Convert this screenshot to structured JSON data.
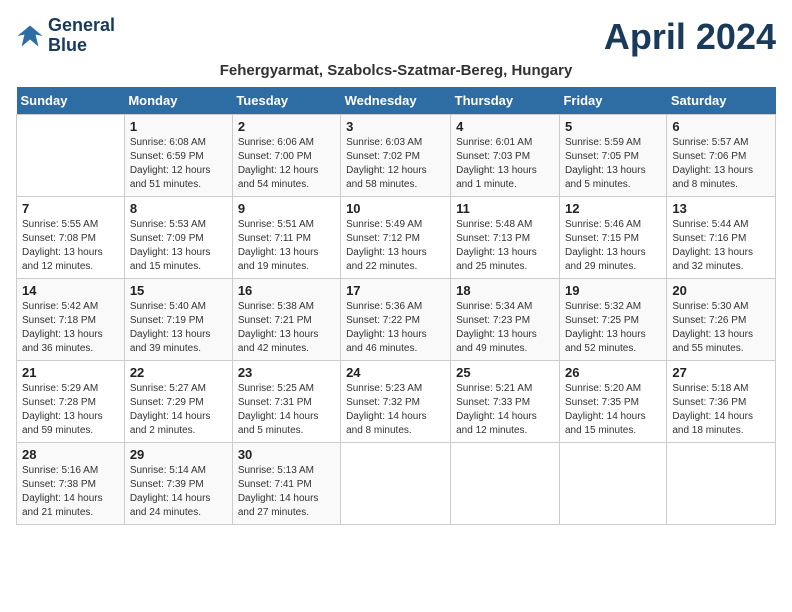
{
  "header": {
    "logo_line1": "General",
    "logo_line2": "Blue",
    "month": "April 2024",
    "location": "Fehergyarmat, Szabolcs-Szatmar-Bereg, Hungary"
  },
  "weekdays": [
    "Sunday",
    "Monday",
    "Tuesday",
    "Wednesday",
    "Thursday",
    "Friday",
    "Saturday"
  ],
  "weeks": [
    [
      {
        "day": "",
        "sunrise": "",
        "sunset": "",
        "daylight": ""
      },
      {
        "day": "1",
        "sunrise": "Sunrise: 6:08 AM",
        "sunset": "Sunset: 6:59 PM",
        "daylight": "Daylight: 12 hours and 51 minutes."
      },
      {
        "day": "2",
        "sunrise": "Sunrise: 6:06 AM",
        "sunset": "Sunset: 7:00 PM",
        "daylight": "Daylight: 12 hours and 54 minutes."
      },
      {
        "day": "3",
        "sunrise": "Sunrise: 6:03 AM",
        "sunset": "Sunset: 7:02 PM",
        "daylight": "Daylight: 12 hours and 58 minutes."
      },
      {
        "day": "4",
        "sunrise": "Sunrise: 6:01 AM",
        "sunset": "Sunset: 7:03 PM",
        "daylight": "Daylight: 13 hours and 1 minute."
      },
      {
        "day": "5",
        "sunrise": "Sunrise: 5:59 AM",
        "sunset": "Sunset: 7:05 PM",
        "daylight": "Daylight: 13 hours and 5 minutes."
      },
      {
        "day": "6",
        "sunrise": "Sunrise: 5:57 AM",
        "sunset": "Sunset: 7:06 PM",
        "daylight": "Daylight: 13 hours and 8 minutes."
      }
    ],
    [
      {
        "day": "7",
        "sunrise": "Sunrise: 5:55 AM",
        "sunset": "Sunset: 7:08 PM",
        "daylight": "Daylight: 13 hours and 12 minutes."
      },
      {
        "day": "8",
        "sunrise": "Sunrise: 5:53 AM",
        "sunset": "Sunset: 7:09 PM",
        "daylight": "Daylight: 13 hours and 15 minutes."
      },
      {
        "day": "9",
        "sunrise": "Sunrise: 5:51 AM",
        "sunset": "Sunset: 7:11 PM",
        "daylight": "Daylight: 13 hours and 19 minutes."
      },
      {
        "day": "10",
        "sunrise": "Sunrise: 5:49 AM",
        "sunset": "Sunset: 7:12 PM",
        "daylight": "Daylight: 13 hours and 22 minutes."
      },
      {
        "day": "11",
        "sunrise": "Sunrise: 5:48 AM",
        "sunset": "Sunset: 7:13 PM",
        "daylight": "Daylight: 13 hours and 25 minutes."
      },
      {
        "day": "12",
        "sunrise": "Sunrise: 5:46 AM",
        "sunset": "Sunset: 7:15 PM",
        "daylight": "Daylight: 13 hours and 29 minutes."
      },
      {
        "day": "13",
        "sunrise": "Sunrise: 5:44 AM",
        "sunset": "Sunset: 7:16 PM",
        "daylight": "Daylight: 13 hours and 32 minutes."
      }
    ],
    [
      {
        "day": "14",
        "sunrise": "Sunrise: 5:42 AM",
        "sunset": "Sunset: 7:18 PM",
        "daylight": "Daylight: 13 hours and 36 minutes."
      },
      {
        "day": "15",
        "sunrise": "Sunrise: 5:40 AM",
        "sunset": "Sunset: 7:19 PM",
        "daylight": "Daylight: 13 hours and 39 minutes."
      },
      {
        "day": "16",
        "sunrise": "Sunrise: 5:38 AM",
        "sunset": "Sunset: 7:21 PM",
        "daylight": "Daylight: 13 hours and 42 minutes."
      },
      {
        "day": "17",
        "sunrise": "Sunrise: 5:36 AM",
        "sunset": "Sunset: 7:22 PM",
        "daylight": "Daylight: 13 hours and 46 minutes."
      },
      {
        "day": "18",
        "sunrise": "Sunrise: 5:34 AM",
        "sunset": "Sunset: 7:23 PM",
        "daylight": "Daylight: 13 hours and 49 minutes."
      },
      {
        "day": "19",
        "sunrise": "Sunrise: 5:32 AM",
        "sunset": "Sunset: 7:25 PM",
        "daylight": "Daylight: 13 hours and 52 minutes."
      },
      {
        "day": "20",
        "sunrise": "Sunrise: 5:30 AM",
        "sunset": "Sunset: 7:26 PM",
        "daylight": "Daylight: 13 hours and 55 minutes."
      }
    ],
    [
      {
        "day": "21",
        "sunrise": "Sunrise: 5:29 AM",
        "sunset": "Sunset: 7:28 PM",
        "daylight": "Daylight: 13 hours and 59 minutes."
      },
      {
        "day": "22",
        "sunrise": "Sunrise: 5:27 AM",
        "sunset": "Sunset: 7:29 PM",
        "daylight": "Daylight: 14 hours and 2 minutes."
      },
      {
        "day": "23",
        "sunrise": "Sunrise: 5:25 AM",
        "sunset": "Sunset: 7:31 PM",
        "daylight": "Daylight: 14 hours and 5 minutes."
      },
      {
        "day": "24",
        "sunrise": "Sunrise: 5:23 AM",
        "sunset": "Sunset: 7:32 PM",
        "daylight": "Daylight: 14 hours and 8 minutes."
      },
      {
        "day": "25",
        "sunrise": "Sunrise: 5:21 AM",
        "sunset": "Sunset: 7:33 PM",
        "daylight": "Daylight: 14 hours and 12 minutes."
      },
      {
        "day": "26",
        "sunrise": "Sunrise: 5:20 AM",
        "sunset": "Sunset: 7:35 PM",
        "daylight": "Daylight: 14 hours and 15 minutes."
      },
      {
        "day": "27",
        "sunrise": "Sunrise: 5:18 AM",
        "sunset": "Sunset: 7:36 PM",
        "daylight": "Daylight: 14 hours and 18 minutes."
      }
    ],
    [
      {
        "day": "28",
        "sunrise": "Sunrise: 5:16 AM",
        "sunset": "Sunset: 7:38 PM",
        "daylight": "Daylight: 14 hours and 21 minutes."
      },
      {
        "day": "29",
        "sunrise": "Sunrise: 5:14 AM",
        "sunset": "Sunset: 7:39 PM",
        "daylight": "Daylight: 14 hours and 24 minutes."
      },
      {
        "day": "30",
        "sunrise": "Sunrise: 5:13 AM",
        "sunset": "Sunset: 7:41 PM",
        "daylight": "Daylight: 14 hours and 27 minutes."
      },
      {
        "day": "",
        "sunrise": "",
        "sunset": "",
        "daylight": ""
      },
      {
        "day": "",
        "sunrise": "",
        "sunset": "",
        "daylight": ""
      },
      {
        "day": "",
        "sunrise": "",
        "sunset": "",
        "daylight": ""
      },
      {
        "day": "",
        "sunrise": "",
        "sunset": "",
        "daylight": ""
      }
    ]
  ]
}
